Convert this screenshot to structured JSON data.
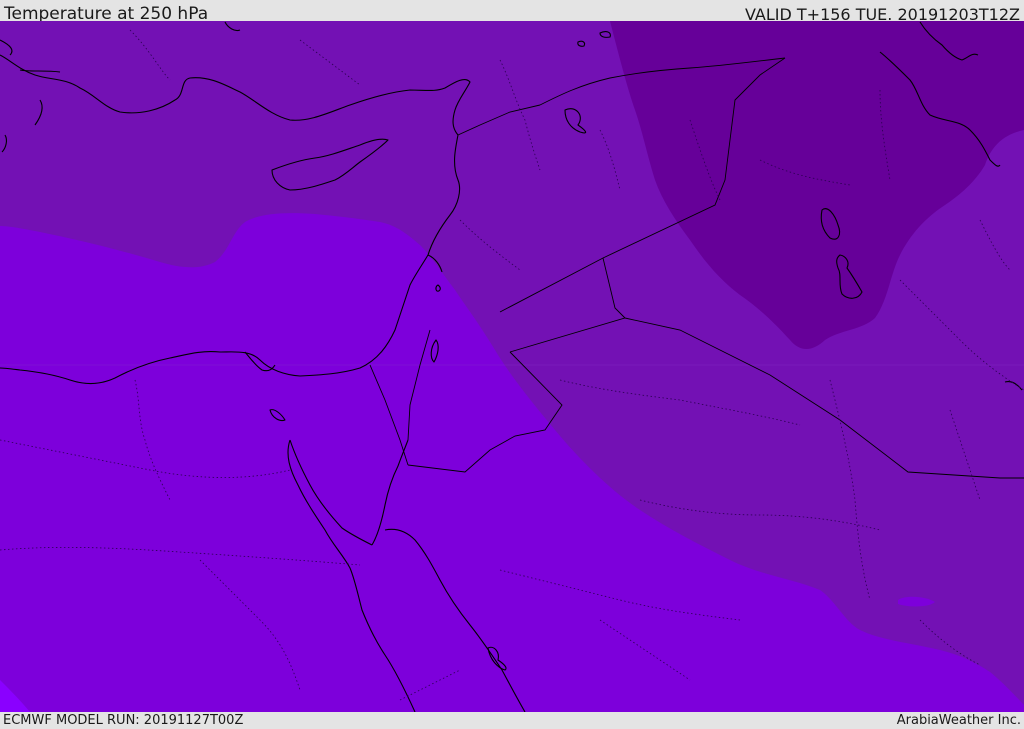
{
  "header": {
    "title": "Temperature at 250 hPa",
    "valid_time": "VALID T+156 TUE. 20191203T12Z"
  },
  "footer": {
    "model_run": "ECMWF MODEL RUN: 20191127T00Z",
    "credit": "ArabiaWeather Inc."
  },
  "map": {
    "region": "Eastern Mediterranean and Middle East",
    "field": "temperature-250hPa",
    "colors": {
      "warmest_band": "#7d00db",
      "mid_band": "#7311b4",
      "cold_band": "#660099",
      "southwest_corner": "#8a00ff",
      "coastline": "#000000",
      "border_dotted": "#2a0050"
    }
  }
}
